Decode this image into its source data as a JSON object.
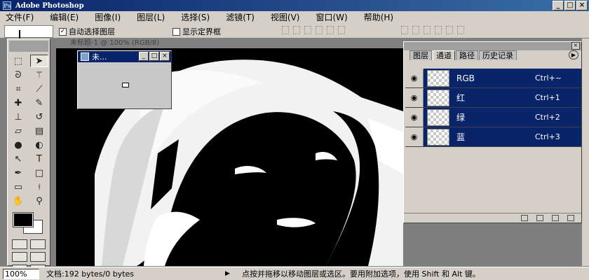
{
  "window": {
    "title": "Adobe Photoshop",
    "buttons": [
      "_",
      "□",
      "×"
    ]
  },
  "menu": [
    "文件(F)",
    "编辑(E)",
    "图像(I)",
    "图层(L)",
    "选择(S)",
    "滤镜(T)",
    "视图(V)",
    "窗口(W)",
    "帮助(H)"
  ],
  "options": {
    "auto_select": "自动选择图层",
    "auto_select_checked": "✓",
    "show_bounds": "显示定界框"
  },
  "document": {
    "title": "未标题-1 @ 100% (RGB/8)"
  },
  "navigator": {
    "title": "未..."
  },
  "channels_panel": {
    "tabs": [
      "图层",
      "通道",
      "路径",
      "历史记录"
    ],
    "active_tab": "通道",
    "rows": [
      {
        "name": "RGB",
        "shortcut": "Ctrl+~"
      },
      {
        "name": "红",
        "shortcut": "Ctrl+1"
      },
      {
        "name": "绿",
        "shortcut": "Ctrl+2"
      },
      {
        "name": "蓝",
        "shortcut": "Ctrl+3"
      }
    ]
  },
  "tools": [
    "marquee-tool",
    "move-tool",
    "lasso-tool",
    "magic-wand-tool",
    "crop-tool",
    "slice-tool",
    "healing-tool",
    "brush-tool",
    "stamp-tool",
    "history-brush-tool",
    "eraser-tool",
    "gradient-tool",
    "blur-tool",
    "dodge-tool",
    "path-select-tool",
    "type-tool",
    "pen-tool",
    "shape-tool",
    "notes-tool",
    "eyedropper-tool",
    "hand-tool",
    "zoom-tool"
  ],
  "status": {
    "zoom": "100%",
    "doc": "文档:192 bytes/0 bytes",
    "hint": "点按并拖移以移动图层或选区。要用附加选项，使用 Shift 和 Alt 键。"
  }
}
